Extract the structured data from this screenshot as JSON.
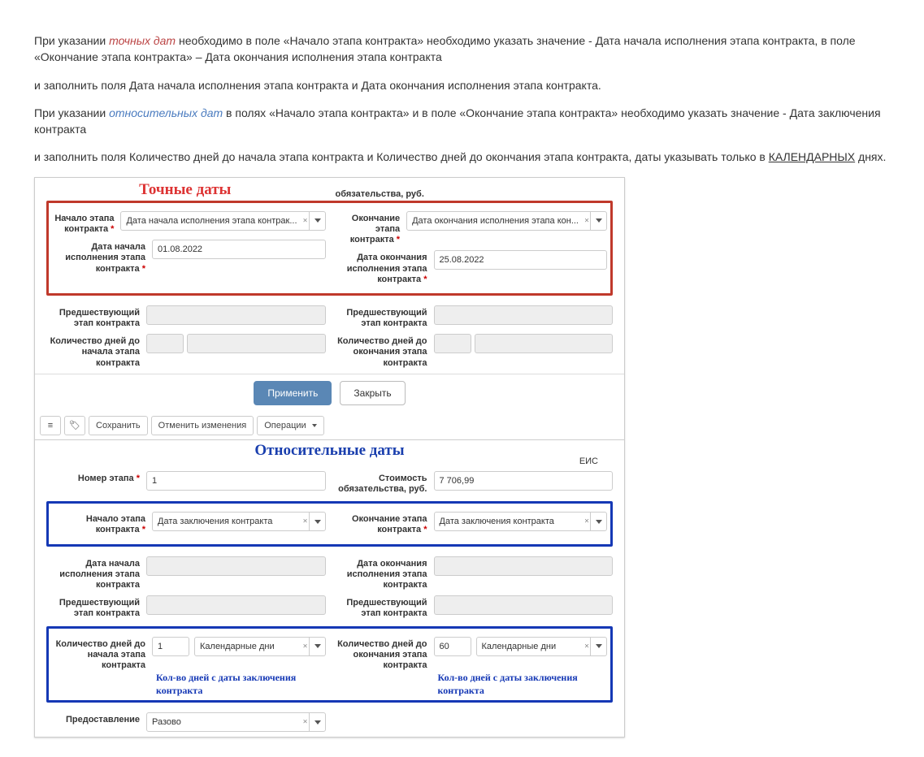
{
  "paragraphs": {
    "p1a": "При указании ",
    "p1em": "точных дат",
    "p1b": " необходимо в поле «Начало этапа контракта» необходимо указать значение - Дата начала исполнения этапа контракта, в поле «Окончание этапа контракта» – Дата окончания исполнения этапа контракта",
    "p2": "и заполнить поля Дата начала исполнения этапа контракта и Дата окончания исполнения этапа контракта.",
    "p3a": "При указании ",
    "p3em": "относительных дат",
    "p3b": " в полях «Начало этапа контракта» и в поле «Окончание этапа контракта» необходимо указать значение - Дата заключения контракта",
    "p4a": "и заполнить поля Количество дней до начала этапа контракта и Количество дней до окончания этапа контракта, даты указывать только в ",
    "p4u": "КАЛЕНДАРНЫХ",
    "p4b": " днях."
  },
  "shot1": {
    "title": "Точные даты",
    "topnote": "обязательства, руб.",
    "left": {
      "start_label": "Начало этапа контракта",
      "start_value": "Дата начала исполнения этапа контрак...",
      "date_label": "Дата начала исполнения этапа контракта",
      "date_value": "01.08.2022",
      "prev_label": "Предшествующий этап контракта",
      "days_label": "Количество дней до начала этапа контракта"
    },
    "right": {
      "end_label": "Окончание этапа контракта",
      "end_value": "Дата окончания исполнения этапа кон...",
      "date_label": "Дата окончания исполнения этапа контракта",
      "date_value": "25.08.2022",
      "prev_label": "Предшествующий этап контракта",
      "days_label": "Количество дней до окончания этапа контракта"
    },
    "apply": "Применить",
    "close": "Закрыть"
  },
  "shot2": {
    "toolbar": {
      "save": "Сохранить",
      "cancel": "Отменить изменения",
      "ops": "Операции"
    },
    "title": "Относительные даты",
    "eis": "ЕИС",
    "num_label": "Номер этапа",
    "num_value": "1",
    "cost_label": "Стоимость обязательства, руб.",
    "cost_value": "7 706,99",
    "left": {
      "start_label": "Начало этапа контракта",
      "start_value": "Дата заключения контракта",
      "date_label": "Дата начала исполнения этапа контракта",
      "prev_label": "Предшествующий этап контракта",
      "days_label": "Количество дней до начала этапа контракта",
      "days_value": "1",
      "days_type": "Календарные дни",
      "anno": "Кол-во дней с даты заключения контракта",
      "prov_label": "Предоставление",
      "prov_value": "Разово"
    },
    "right": {
      "end_label": "Окончание этапа контракта",
      "end_value": "Дата заключения контракта",
      "date_label": "Дата окончания исполнения этапа контракта",
      "prev_label": "Предшествующий этап контракта",
      "days_label": "Количество дней до окончания этапа контракта",
      "days_value": "60",
      "days_type": "Календарные дни",
      "anno": "Кол-во дней с даты заключения контракта"
    }
  }
}
